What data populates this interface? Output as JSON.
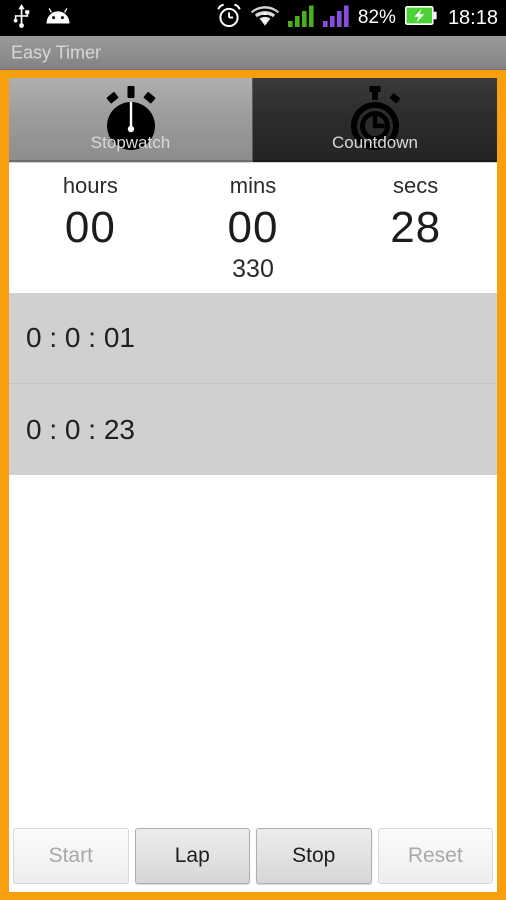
{
  "status_bar": {
    "left_icons": [
      {
        "name": "usb-icon",
        "glyph": "usb"
      },
      {
        "name": "android-robot-icon",
        "glyph": "android"
      }
    ],
    "right_icons": [
      {
        "name": "alarm-clock-icon",
        "glyph": "alarm"
      },
      {
        "name": "wifi-icon",
        "glyph": "wifi"
      },
      {
        "name": "cellular-signal-icon-1",
        "glyph": "signal",
        "color": "#4caf17"
      },
      {
        "name": "cellular-signal-icon-2",
        "glyph": "signal",
        "color": "#8a4ce0"
      }
    ],
    "battery_percent": "82%",
    "battery_state": "charging",
    "battery_color": "#4cd137",
    "clock": "18:18"
  },
  "title_bar": {
    "title": "Easy Timer"
  },
  "theme": {
    "accent": "#f79f0c",
    "list_bg": "#d0d0d0",
    "selected_tab_bg": "#9d9d9d",
    "unselected_tab_bg": "#2d2d2d"
  },
  "tabs": [
    {
      "label": "Stopwatch",
      "icon": "stopwatch-icon",
      "selected": true
    },
    {
      "label": "Countdown",
      "icon": "countdown-timer-icon",
      "selected": false
    }
  ],
  "timer": {
    "columns": [
      {
        "label": "hours",
        "value": "00"
      },
      {
        "label": "mins",
        "value": "00"
      },
      {
        "label": "secs",
        "value": "28"
      }
    ],
    "millis": "330"
  },
  "laps": [
    {
      "text": "0 : 0 : 01"
    },
    {
      "text": "0 : 0 : 23"
    }
  ],
  "buttons": [
    {
      "label": "Start",
      "enabled": false
    },
    {
      "label": "Lap",
      "enabled": true
    },
    {
      "label": "Stop",
      "enabled": true
    },
    {
      "label": "Reset",
      "enabled": false
    }
  ]
}
